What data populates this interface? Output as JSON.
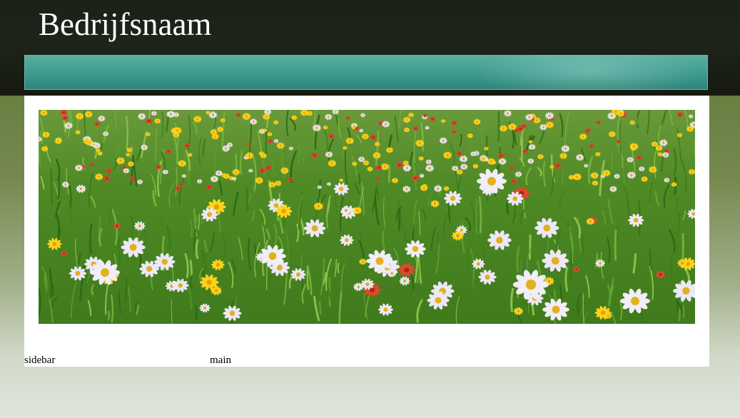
{
  "header": {
    "site_title": "Bedrijfsnaam"
  },
  "nav": {
    "items": []
  },
  "banner": {
    "image": "wildflower-meadow"
  },
  "layout_labels": {
    "sidebar": "sidebar",
    "main": "main"
  },
  "colors": {
    "header_bg": "#1b2117",
    "nav_bg": "#3f9a8e",
    "page_bg_top": "#697f42",
    "page_bg_bottom": "#e0e5dc",
    "content_bg": "#ffffff"
  }
}
